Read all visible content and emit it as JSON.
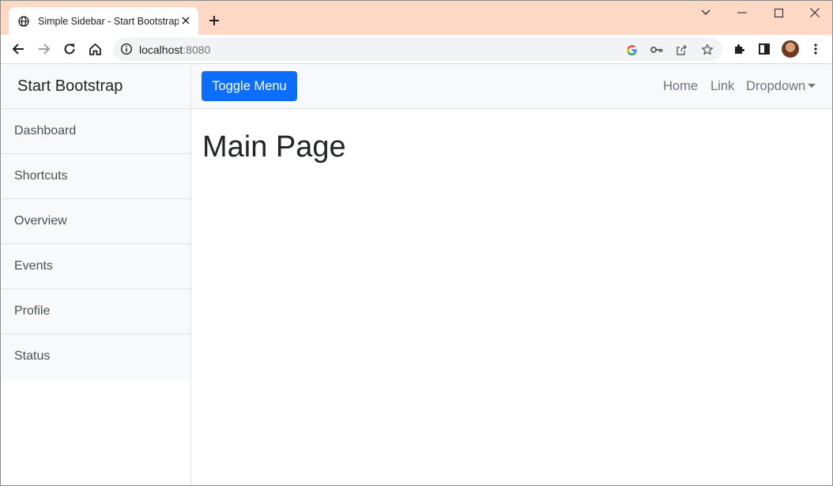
{
  "browser": {
    "tab_title": "Simple Sidebar - Start Bootstrap",
    "url_host": "localhost",
    "url_port": ":8080"
  },
  "sidebar": {
    "heading": "Start Bootstrap",
    "items": [
      {
        "label": "Dashboard"
      },
      {
        "label": "Shortcuts"
      },
      {
        "label": "Overview"
      },
      {
        "label": "Events"
      },
      {
        "label": "Profile"
      },
      {
        "label": "Status"
      }
    ]
  },
  "navbar": {
    "toggle_label": "Toggle Menu",
    "links": [
      {
        "label": "Home"
      },
      {
        "label": "Link"
      },
      {
        "label": "Dropdown"
      }
    ]
  },
  "main": {
    "title": "Main Page"
  },
  "colors": {
    "titlebar": "#fcd8c5",
    "primary": "#0d6efd",
    "sidebar_bg": "#f8f9fa"
  }
}
